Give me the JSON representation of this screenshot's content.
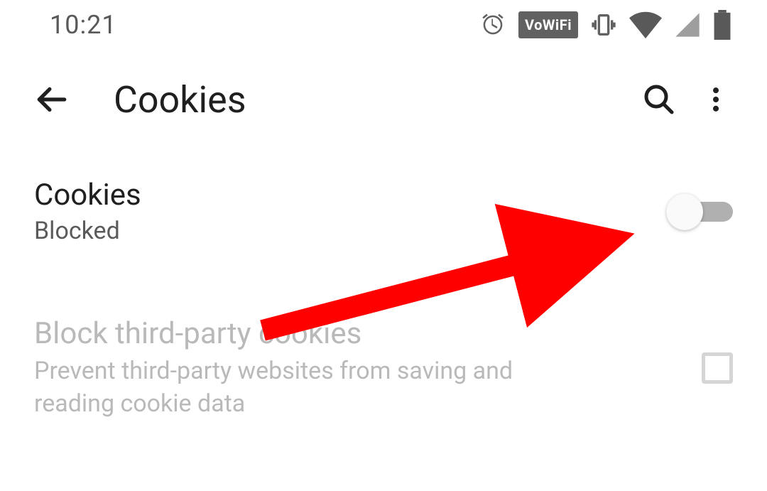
{
  "status": {
    "time": "10:21",
    "vowifi_label": "VoWiFi"
  },
  "toolbar": {
    "title": "Cookies"
  },
  "settings": {
    "cookies": {
      "title": "Cookies",
      "subtitle": "Blocked",
      "value": false
    },
    "third_party": {
      "title": "Block third-party cookies",
      "subtitle": "Prevent third-party websites from saving and reading cookie data",
      "checked": false,
      "enabled": false
    }
  },
  "annotation": {
    "arrow_color": "#ff0000"
  }
}
